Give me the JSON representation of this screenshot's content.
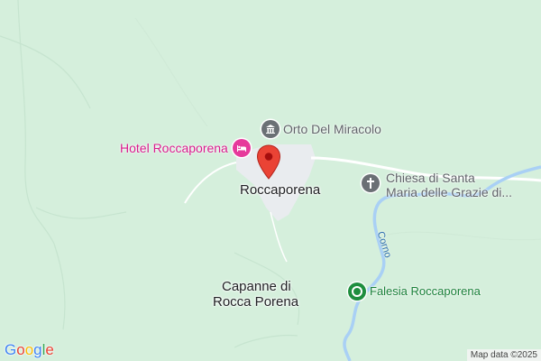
{
  "map": {
    "colors": {
      "land": "#d5efdc",
      "road": "#ffffff",
      "town_area": "#e9ecef",
      "river": "#a9d0f5",
      "pin": "#ea4335"
    },
    "town": {
      "name": "Roccaporena"
    },
    "locality": {
      "name_line1": "Capanne di",
      "name_line2": "Rocca Porena"
    },
    "river": {
      "name": "Corno"
    },
    "pois": {
      "orto": {
        "name": "Orto Del Miracolo",
        "icon": "museum-icon"
      },
      "hotel": {
        "name": "Hotel Roccaporena",
        "icon": "bed-icon"
      },
      "chiesa": {
        "name_line1": "Chiesa di Santa",
        "name_line2": "Maria delle Grazie di...",
        "icon": "cross-icon"
      },
      "falesia": {
        "name": "Falesia Roccaporena",
        "icon": "climbing-area-icon"
      }
    }
  },
  "branding": {
    "logo_letters": [
      "G",
      "o",
      "o",
      "g",
      "l",
      "e"
    ],
    "logo_colors": [
      "#4285f4",
      "#ea4335",
      "#fbbc05",
      "#4285f4",
      "#34a853",
      "#ea4335"
    ]
  },
  "attribution": "Map data ©2025"
}
